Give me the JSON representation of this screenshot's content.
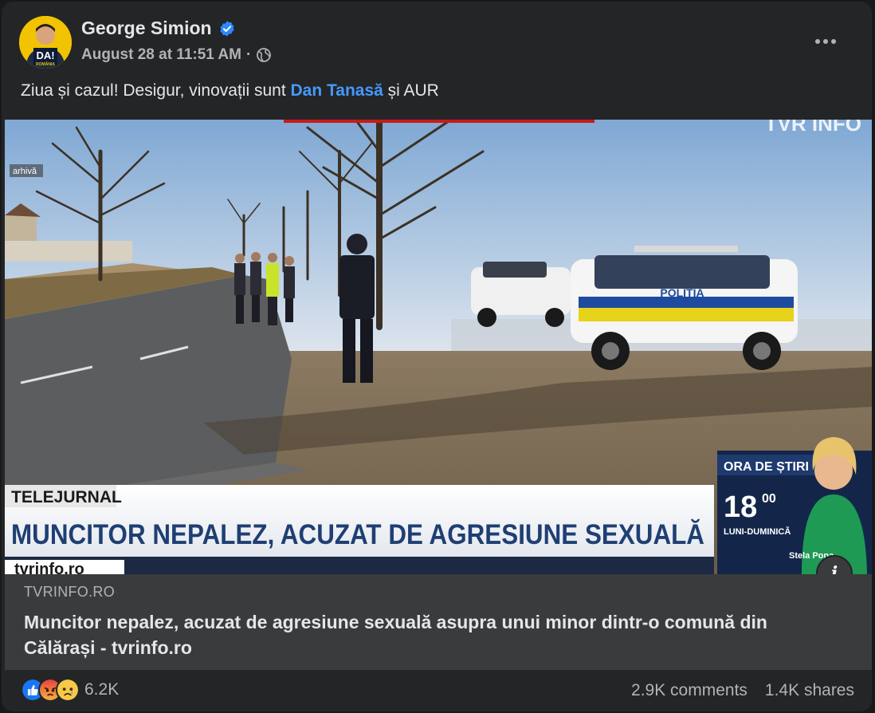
{
  "post": {
    "author": "George Simion",
    "timestamp": "August 28 at 11:51 AM",
    "separator": "·",
    "avatar_badge": "DA!",
    "avatar_sub": "ROMÂNIA",
    "text_before": "Ziua și cazul! Desigur, vinovații sunt ",
    "mention": "Dan Tanasă",
    "text_after": " și AUR"
  },
  "media": {
    "archive_tag": "arhivă",
    "channel_logo": "TVR INFO",
    "show_name": "TELEJURNAL",
    "headline": "MUNCITOR NEPALEZ, ACUZAT DE AGRESIUNE SEXUALĂ",
    "website": "tvrinfo.ro",
    "news_box_title": "ORA DE ȘTIRI",
    "news_hour": "18",
    "news_minutes": "00",
    "news_days": "LUNI-DUMINICĂ",
    "presenter": "Stela Popa",
    "police_text": "POLIȚIA"
  },
  "link": {
    "domain": "TVRINFO.RO",
    "title": "Muncitor nepalez, acuzat de agresiune sexuală asupra unui minor dintr-o comună din Călărași - tvrinfo.ro"
  },
  "footer": {
    "reaction_count": "6.2K",
    "comments": "2.9K comments",
    "shares": "1.4K shares"
  },
  "icons": {
    "verified": "verified-badge-icon",
    "globe": "globe-icon",
    "more": "more-options-icon",
    "info": "info-icon",
    "reactions": [
      "like-icon",
      "angry-icon",
      "sad-icon"
    ]
  },
  "colors": {
    "card_bg": "#242526",
    "link_bg": "#3a3b3c",
    "mention": "#4599ff",
    "verified": "#2d88ff",
    "text_primary": "#e4e6eb",
    "text_secondary": "#b0b3b8"
  }
}
